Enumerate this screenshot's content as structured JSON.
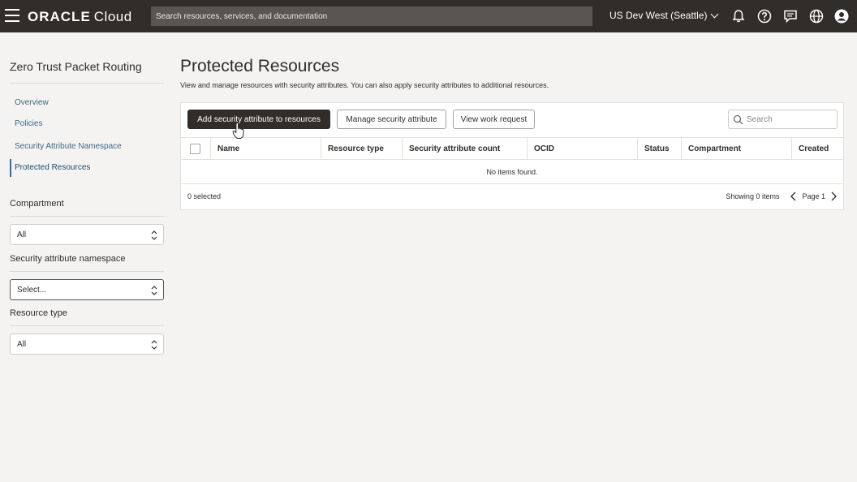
{
  "topbar": {
    "brand_primary": "ORACLE",
    "brand_secondary": "Cloud",
    "search_placeholder": "Search resources, services, and documentation",
    "region": "US Dev West (Seattle)",
    "icons": [
      "menu-icon",
      "bell-icon",
      "help-icon",
      "chat-icon",
      "globe-icon",
      "user-icon"
    ]
  },
  "sidebar": {
    "title": "Zero Trust Packet Routing",
    "nav": [
      {
        "label": "Overview",
        "active": false
      },
      {
        "label": "Policies",
        "active": false
      },
      {
        "label": "Security Attribute Namespace",
        "active": false
      },
      {
        "label": "Protected Resources",
        "active": true
      }
    ],
    "filters": {
      "compartment": {
        "label": "Compartment",
        "value": "All"
      },
      "namespace": {
        "label": "Security attribute namespace",
        "value": "Select..."
      },
      "resource_type": {
        "label": "Resource type",
        "value": "All"
      }
    }
  },
  "main": {
    "title": "Protected Resources",
    "description": "View and manage resources with security attributes. You can also apply security attributes to additional resources.",
    "buttons": {
      "add": "Add security attribute to resources",
      "manage": "Manage security attribute",
      "view_work": "View work request"
    },
    "search_placeholder": "Search",
    "columns": [
      "Name",
      "Resource type",
      "Security attribute count",
      "OCID",
      "Status",
      "Compartment",
      "Created"
    ],
    "empty_message": "No items found.",
    "selected_text": "0 selected",
    "showing_text": "Showing 0 items",
    "page_text": "Page 1"
  },
  "colors": {
    "topbar": "#312d2a",
    "link": "#3f6786",
    "primary_button": "#312d2a",
    "background": "#f4f3f1"
  }
}
